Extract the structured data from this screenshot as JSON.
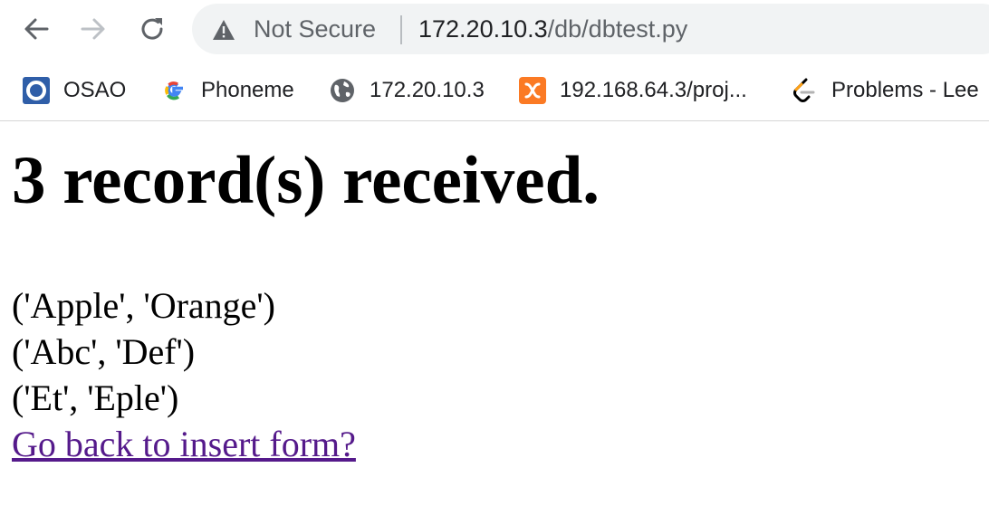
{
  "browser": {
    "security_label": "Not Secure",
    "url_host": "172.20.10.3",
    "url_path": "/db/dbtest.py",
    "icons": {
      "back": "arrow-left-icon",
      "forward": "arrow-right-icon",
      "reload": "reload-icon",
      "security": "warning-triangle-icon"
    },
    "bookmarks": [
      {
        "label": "OSAO",
        "icon": "osao-logo-icon"
      },
      {
        "label": "Phoneme",
        "icon": "google-logo-icon"
      },
      {
        "label": "172.20.10.3",
        "icon": "globe-icon"
      },
      {
        "label": "192.168.64.3/proj...",
        "icon": "xampp-logo-icon"
      },
      {
        "label": "Problems - Lee",
        "icon": "leetcode-logo-icon"
      }
    ]
  },
  "page": {
    "heading": "3 record(s) received.",
    "records": [
      "('Apple', 'Orange')",
      "('Abc', 'Def')",
      "('Et', 'Eple')"
    ],
    "back_link": "Go back to insert form?"
  },
  "colors": {
    "link_visited": "#551a8b",
    "omnibox_bg": "#f1f3f4",
    "chrome_text": "#5f6368"
  }
}
